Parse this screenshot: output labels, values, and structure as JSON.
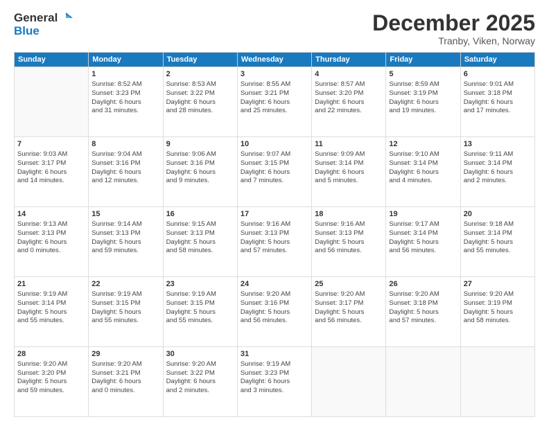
{
  "header": {
    "logo_general": "General",
    "logo_blue": "Blue",
    "month": "December 2025",
    "location": "Tranby, Viken, Norway"
  },
  "calendar": {
    "days_of_week": [
      "Sunday",
      "Monday",
      "Tuesday",
      "Wednesday",
      "Thursday",
      "Friday",
      "Saturday"
    ],
    "weeks": [
      [
        {
          "day": "",
          "info": ""
        },
        {
          "day": "1",
          "info": "Sunrise: 8:52 AM\nSunset: 3:23 PM\nDaylight: 6 hours\nand 31 minutes."
        },
        {
          "day": "2",
          "info": "Sunrise: 8:53 AM\nSunset: 3:22 PM\nDaylight: 6 hours\nand 28 minutes."
        },
        {
          "day": "3",
          "info": "Sunrise: 8:55 AM\nSunset: 3:21 PM\nDaylight: 6 hours\nand 25 minutes."
        },
        {
          "day": "4",
          "info": "Sunrise: 8:57 AM\nSunset: 3:20 PM\nDaylight: 6 hours\nand 22 minutes."
        },
        {
          "day": "5",
          "info": "Sunrise: 8:59 AM\nSunset: 3:19 PM\nDaylight: 6 hours\nand 19 minutes."
        },
        {
          "day": "6",
          "info": "Sunrise: 9:01 AM\nSunset: 3:18 PM\nDaylight: 6 hours\nand 17 minutes."
        }
      ],
      [
        {
          "day": "7",
          "info": "Sunrise: 9:03 AM\nSunset: 3:17 PM\nDaylight: 6 hours\nand 14 minutes."
        },
        {
          "day": "8",
          "info": "Sunrise: 9:04 AM\nSunset: 3:16 PM\nDaylight: 6 hours\nand 12 minutes."
        },
        {
          "day": "9",
          "info": "Sunrise: 9:06 AM\nSunset: 3:16 PM\nDaylight: 6 hours\nand 9 minutes."
        },
        {
          "day": "10",
          "info": "Sunrise: 9:07 AM\nSunset: 3:15 PM\nDaylight: 6 hours\nand 7 minutes."
        },
        {
          "day": "11",
          "info": "Sunrise: 9:09 AM\nSunset: 3:14 PM\nDaylight: 6 hours\nand 5 minutes."
        },
        {
          "day": "12",
          "info": "Sunrise: 9:10 AM\nSunset: 3:14 PM\nDaylight: 6 hours\nand 4 minutes."
        },
        {
          "day": "13",
          "info": "Sunrise: 9:11 AM\nSunset: 3:14 PM\nDaylight: 6 hours\nand 2 minutes."
        }
      ],
      [
        {
          "day": "14",
          "info": "Sunrise: 9:13 AM\nSunset: 3:13 PM\nDaylight: 6 hours\nand 0 minutes."
        },
        {
          "day": "15",
          "info": "Sunrise: 9:14 AM\nSunset: 3:13 PM\nDaylight: 5 hours\nand 59 minutes."
        },
        {
          "day": "16",
          "info": "Sunrise: 9:15 AM\nSunset: 3:13 PM\nDaylight: 5 hours\nand 58 minutes."
        },
        {
          "day": "17",
          "info": "Sunrise: 9:16 AM\nSunset: 3:13 PM\nDaylight: 5 hours\nand 57 minutes."
        },
        {
          "day": "18",
          "info": "Sunrise: 9:16 AM\nSunset: 3:13 PM\nDaylight: 5 hours\nand 56 minutes."
        },
        {
          "day": "19",
          "info": "Sunrise: 9:17 AM\nSunset: 3:14 PM\nDaylight: 5 hours\nand 56 minutes."
        },
        {
          "day": "20",
          "info": "Sunrise: 9:18 AM\nSunset: 3:14 PM\nDaylight: 5 hours\nand 55 minutes."
        }
      ],
      [
        {
          "day": "21",
          "info": "Sunrise: 9:19 AM\nSunset: 3:14 PM\nDaylight: 5 hours\nand 55 minutes."
        },
        {
          "day": "22",
          "info": "Sunrise: 9:19 AM\nSunset: 3:15 PM\nDaylight: 5 hours\nand 55 minutes."
        },
        {
          "day": "23",
          "info": "Sunrise: 9:19 AM\nSunset: 3:15 PM\nDaylight: 5 hours\nand 55 minutes."
        },
        {
          "day": "24",
          "info": "Sunrise: 9:20 AM\nSunset: 3:16 PM\nDaylight: 5 hours\nand 56 minutes."
        },
        {
          "day": "25",
          "info": "Sunrise: 9:20 AM\nSunset: 3:17 PM\nDaylight: 5 hours\nand 56 minutes."
        },
        {
          "day": "26",
          "info": "Sunrise: 9:20 AM\nSunset: 3:18 PM\nDaylight: 5 hours\nand 57 minutes."
        },
        {
          "day": "27",
          "info": "Sunrise: 9:20 AM\nSunset: 3:19 PM\nDaylight: 5 hours\nand 58 minutes."
        }
      ],
      [
        {
          "day": "28",
          "info": "Sunrise: 9:20 AM\nSunset: 3:20 PM\nDaylight: 5 hours\nand 59 minutes."
        },
        {
          "day": "29",
          "info": "Sunrise: 9:20 AM\nSunset: 3:21 PM\nDaylight: 6 hours\nand 0 minutes."
        },
        {
          "day": "30",
          "info": "Sunrise: 9:20 AM\nSunset: 3:22 PM\nDaylight: 6 hours\nand 2 minutes."
        },
        {
          "day": "31",
          "info": "Sunrise: 9:19 AM\nSunset: 3:23 PM\nDaylight: 6 hours\nand 3 minutes."
        },
        {
          "day": "",
          "info": ""
        },
        {
          "day": "",
          "info": ""
        },
        {
          "day": "",
          "info": ""
        }
      ]
    ]
  }
}
